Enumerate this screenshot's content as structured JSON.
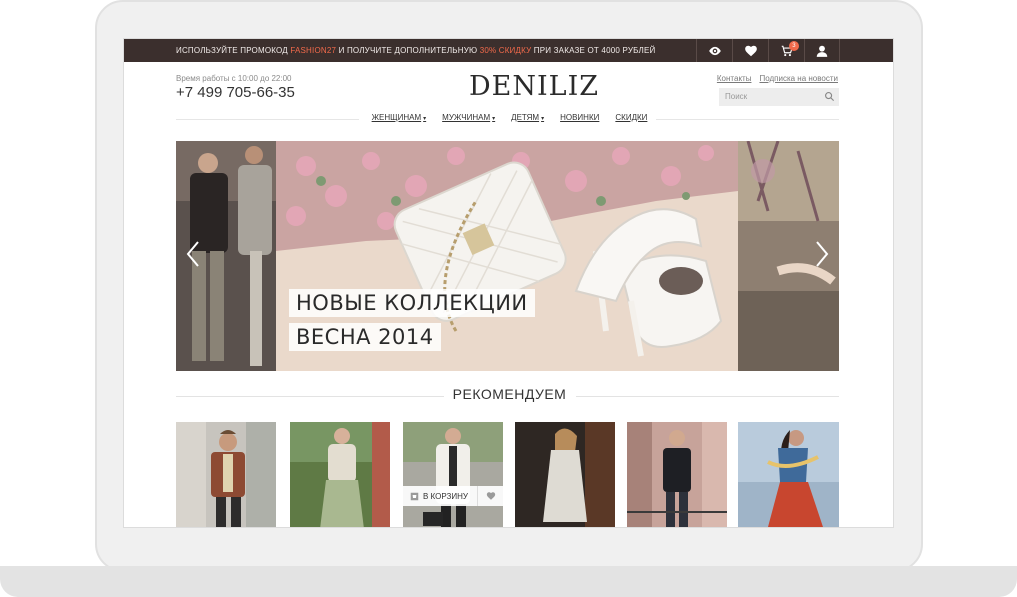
{
  "promo": {
    "text_before": "ИСПОЛЬЗУЙТЕ ПРОМОКОД ",
    "code": "FASHION27",
    "text_middle": " И ПОЛУЧИТЕ ДОПОЛНИТЕЛЬНУЮ ",
    "discount": "30% СКИДКУ",
    "text_after": " ПРИ ЗАКАЗЕ ОТ 4000 РУБЛЕЙ",
    "icons": [
      "eye-icon",
      "heart-icon",
      "cart-icon",
      "user-icon"
    ],
    "cart_count": "3",
    "accent_color": "#f26a4b",
    "bar_color": "#3b2f2d"
  },
  "header": {
    "hours": "Время работы с 10:00 до 22:00",
    "phone": "+7 499 705-66-35",
    "logo": "DENILIZ",
    "links": [
      "Контакты",
      "Подписка на новости"
    ],
    "search_placeholder": "Поиск"
  },
  "nav": {
    "items": [
      {
        "label": "ЖЕНЩИНАМ",
        "dropdown": true
      },
      {
        "label": "МУЖЧИНАМ",
        "dropdown": true
      },
      {
        "label": "ДЕТЯМ",
        "dropdown": true
      },
      {
        "label": "НОВИНКИ",
        "dropdown": false
      },
      {
        "label": "СКИДКИ",
        "dropdown": false
      }
    ]
  },
  "hero": {
    "caption_line1": "НОВЫЕ КОЛЛЕКЦИИ",
    "caption_line2": "ВЕСНА 2014"
  },
  "recommend": {
    "title": "РЕКОМЕНДУЕМ",
    "add_to_cart": "В КОРЗИНУ"
  }
}
